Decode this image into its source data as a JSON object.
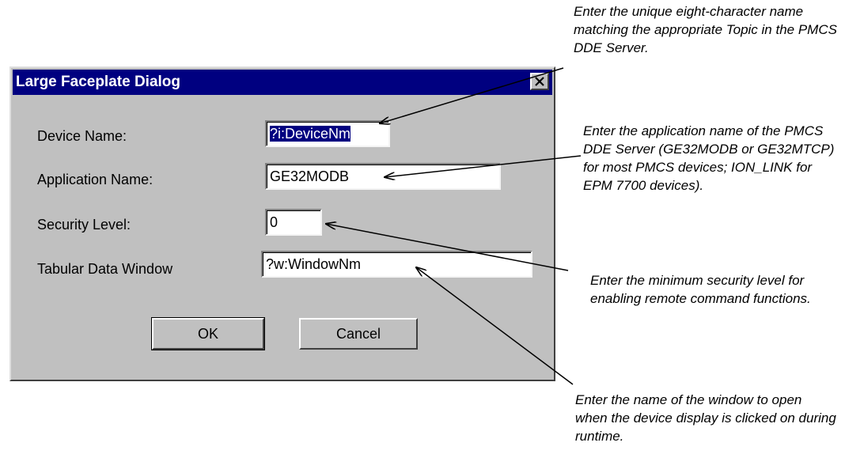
{
  "dialog": {
    "title": "Large Faceplate Dialog",
    "close_symbol": "×",
    "fields": {
      "device_name": {
        "label": "Device Name:",
        "value": "?i:DeviceNm"
      },
      "application_name": {
        "label": "Application Name:",
        "value": "GE32MODB"
      },
      "security_level": {
        "label": "Security Level:",
        "value": "0"
      },
      "tabular_data_window": {
        "label": "Tabular Data Window",
        "value": "?w:WindowNm"
      }
    },
    "buttons": {
      "ok": "OK",
      "cancel": "Cancel"
    }
  },
  "annotations": {
    "device_name": "Enter the unique eight-character name matching the appropriate Topic in the PMCS DDE Server.",
    "application_name": "Enter the application name of the PMCS DDE Server (GE32MODB or GE32MTCP) for most PMCS devices; ION_LINK for EPM 7700 devices).",
    "security_level": "Enter the minimum security level for enabling remote command functions.",
    "tabular_data_window": "Enter the name of the window to open when the device display is clicked on during runtime."
  },
  "icons": {
    "close": "close-icon",
    "arrow": "arrow-icon"
  }
}
